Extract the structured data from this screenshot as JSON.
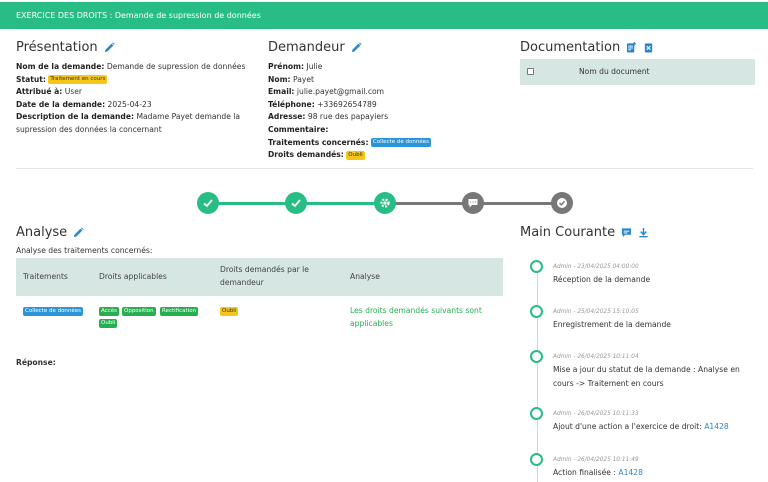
{
  "header": {
    "title": "EXERCICE DES DROITS : Demande de supression de données"
  },
  "presentation": {
    "title": "Présentation",
    "nom_label": "Nom de la demande:",
    "nom_value": "Demande de supression de données",
    "statut_label": "Statut:",
    "statut_value": "Traitement en cours",
    "attribue_label": "Attribué à:",
    "attribue_value": "User",
    "date_label": "Date de la demande:",
    "date_value": "2025-04-23",
    "desc_label": "Description de la demande:",
    "desc_value": "Madame  Payet demande la",
    "desc_value2": "supression des données la concernant"
  },
  "demandeur": {
    "title": "Demandeur",
    "prenom_label": "Prénom:",
    "prenom_value": "Julie",
    "nom_label": "Nom:",
    "nom_value": "Payet",
    "email_label": "Email:",
    "email_value": "julie.payet@gmail.com",
    "tel_label": "Téléphone:",
    "tel_value": "+33692654789",
    "adresse_label": "Adresse:",
    "adresse_value": "98 rue des papayiers",
    "commentaire_label": "Commentaire:",
    "traitements_label": "Traitements concernés:",
    "traitements_value": "Collecte de données",
    "droits_label": "Droits demandés:",
    "droits_value": "Oubli"
  },
  "documentation": {
    "title": "Documentation",
    "column": "Nom du document"
  },
  "progress": {
    "steps": [
      "check",
      "check",
      "gear",
      "comment",
      "check-badge"
    ],
    "completed": 3,
    "colors": {
      "done": "#27bd84",
      "todo": "#777777"
    }
  },
  "analyse": {
    "title": "Analyse",
    "subtitle": "Analyse des traitements concernés:",
    "columns": [
      "Traitements",
      "Droits applicables",
      "Droits demandés par le",
      "demandeur",
      "Analyse"
    ],
    "row": {
      "traitement": "Collecte de données",
      "droits_applicables": [
        "Accès",
        "Opposition",
        "Rectification",
        "Oubli"
      ],
      "droits_demandes": "Oubli",
      "analyse": "Les droits demandés suivants sont",
      "analyse2": "applicables"
    },
    "reponse_label": "Réponse:"
  },
  "main_courante": {
    "title": "Main Courante",
    "entries": [
      {
        "meta": "Admin - 23/04/2025 04:00:00",
        "text": "Réception de la demande"
      },
      {
        "meta": "Admin - 25/04/2025 15:10:05",
        "text": "Enregistrement de la demande"
      },
      {
        "meta": "Admin - 26/04/2025 10:11:04",
        "text": "Mise a jour du statut de la demande : Analyse en",
        "text2": "cours -> Traitement en cours"
      },
      {
        "meta": "Admin - 26/04/2025 10:11:33",
        "text": "Ajout d'une action a l'exercice de droit:",
        "link": "A1428"
      },
      {
        "meta": "Admin - 26/04/2025 10:11:49",
        "text": "Action finalisée :",
        "link": "A1428"
      }
    ]
  },
  "colors": {
    "accent": "#27bd84",
    "blue": "#2b86cc",
    "yellow": "#f5c518"
  }
}
